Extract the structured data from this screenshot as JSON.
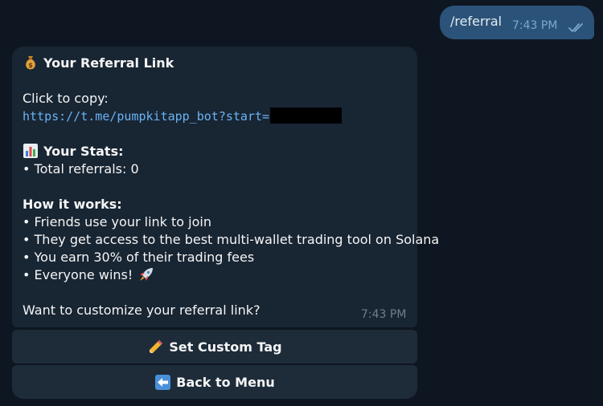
{
  "outgoing_message": {
    "text": "/referral",
    "time": "7:43 PM",
    "status_icon": "double-check-icon"
  },
  "incoming_message": {
    "title": "Your Referral Link",
    "title_icon": "money-bag-icon",
    "copy_label": "Click to copy:",
    "link": "https://t.me/pumpkitapp_bot?start=",
    "stats_heading": "Your Stats:",
    "stats_icon": "bar-chart-icon",
    "total_referrals": "• Total referrals: 0",
    "how_heading": "How it works:",
    "bullets": [
      "• Friends use your link to join",
      "• They get access to the best multi-wallet trading tool on Solana",
      "• You earn 30% of their trading fees",
      "• Everyone wins!"
    ],
    "bullet_end_icon": "rocket-icon",
    "question": "Want to customize your referral link?",
    "time": "7:43 PM"
  },
  "buttons": [
    {
      "label": "Set Custom Tag",
      "icon": "pencil-icon"
    },
    {
      "label": "Back to Menu",
      "icon": "back-arrow-icon"
    }
  ],
  "colors": {
    "background": "#0e1621",
    "outgoing_bubble": "#2b5278",
    "incoming_bubble": "#182533",
    "button": "#1e2c3a",
    "link": "#6ab3f3"
  }
}
